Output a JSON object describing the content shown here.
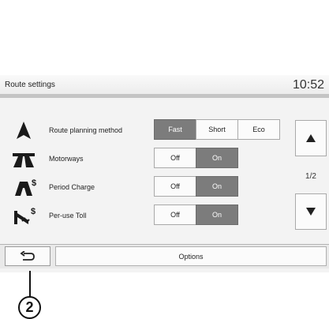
{
  "header": {
    "title": "Route settings",
    "clock": "10:52"
  },
  "rows": [
    {
      "label": "Route planning method",
      "icon": "navigation-arrow-icon",
      "options": [
        {
          "label": "Fast",
          "selected": true
        },
        {
          "label": "Short",
          "selected": false
        },
        {
          "label": "Eco",
          "selected": false
        }
      ]
    },
    {
      "label": "Motorways",
      "icon": "motorway-icon",
      "options": [
        {
          "label": "Off",
          "selected": false
        },
        {
          "label": "On",
          "selected": true
        }
      ]
    },
    {
      "label": "Period Charge",
      "icon": "period-charge-icon",
      "icon_text": "$",
      "options": [
        {
          "label": "Off",
          "selected": false
        },
        {
          "label": "On",
          "selected": true
        }
      ]
    },
    {
      "label": "Per-use Toll",
      "icon": "per-use-toll-icon",
      "icon_text": "$",
      "options": [
        {
          "label": "Off",
          "selected": false
        },
        {
          "label": "On",
          "selected": true
        }
      ]
    }
  ],
  "pagination": {
    "indicator": "1/2",
    "up_icon": "arrow-up-icon",
    "down_icon": "arrow-down-icon"
  },
  "bottom": {
    "back_icon": "back-arrow-icon",
    "options_label": "Options"
  },
  "callout": {
    "number": "2"
  },
  "colors": {
    "selected": "#7c7c7c",
    "unselected": "#fbfbfb",
    "header_line": "#c4c4c4"
  }
}
